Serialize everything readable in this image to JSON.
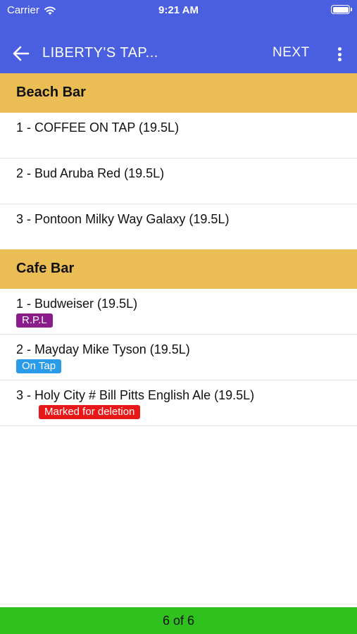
{
  "status_bar": {
    "carrier": "Carrier",
    "time": "9:21 AM"
  },
  "app_bar": {
    "title": "LIBERTY'S TAP...",
    "next_label": "NEXT"
  },
  "sections": [
    {
      "name": "Beach Bar",
      "items": [
        {
          "label": "1 - COFFEE ON TAP (19.5L)"
        },
        {
          "label": "2 - Bud Aruba Red (19.5L)"
        },
        {
          "label": "3 - Pontoon Milky Way Galaxy (19.5L)"
        }
      ]
    },
    {
      "name": "Cafe Bar",
      "items": [
        {
          "label": "1 - Budweiser (19.5L)",
          "badge": "R.P.L",
          "badge_color": "#8a1c8c"
        },
        {
          "label": "2 - Mayday Mike Tyson (19.5L)",
          "badge": "On Tap",
          "badge_color": "#2a9be8"
        },
        {
          "label": "3 - Holy City # Bill Pitts English Ale (19.5L)",
          "badge": "Marked for deletion",
          "badge_color": "#e81818"
        }
      ]
    }
  ],
  "footer": {
    "page_indicator": "6 of 6"
  },
  "colors": {
    "app_bar": "#4a5fe0",
    "section_header": "#ebbd55",
    "footer": "#2fc11d"
  }
}
